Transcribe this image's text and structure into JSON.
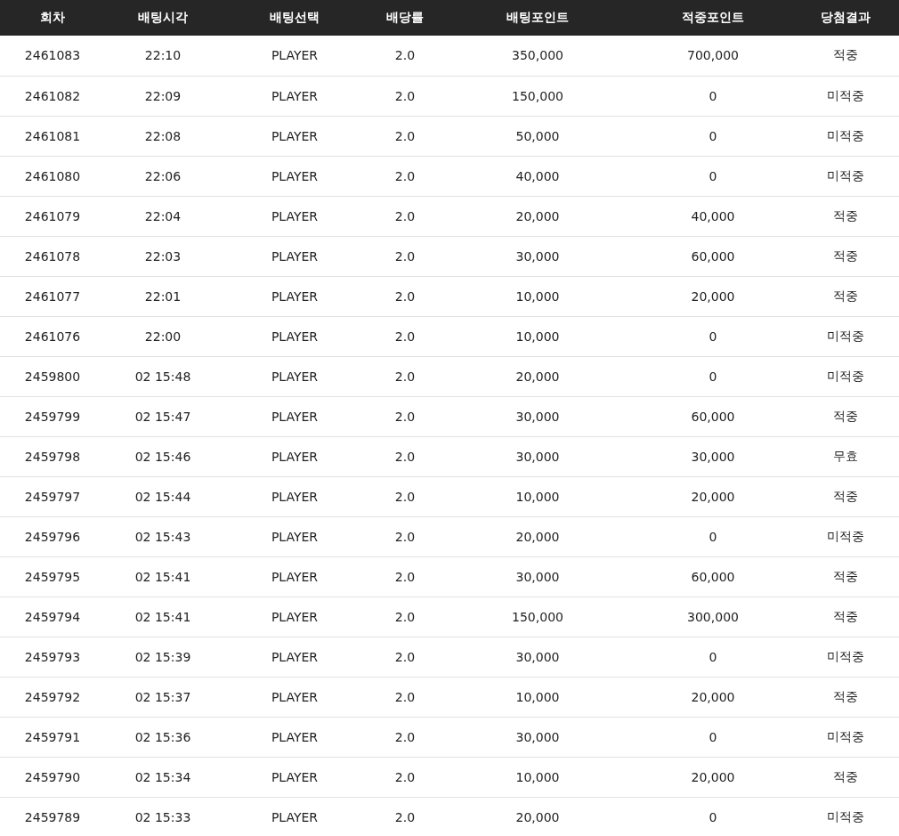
{
  "table": {
    "columns": [
      "회차",
      "배팅시각",
      "배팅선택",
      "배당률",
      "배팅포인트",
      "적중포인트",
      "당첨결과"
    ],
    "rows": [
      [
        "2461083",
        "22:10",
        "PLAYER",
        "2.0",
        "350,000",
        "700,000",
        "적중"
      ],
      [
        "2461082",
        "22:09",
        "PLAYER",
        "2.0",
        "150,000",
        "0",
        "미적중"
      ],
      [
        "2461081",
        "22:08",
        "PLAYER",
        "2.0",
        "50,000",
        "0",
        "미적중"
      ],
      [
        "2461080",
        "22:06",
        "PLAYER",
        "2.0",
        "40,000",
        "0",
        "미적중"
      ],
      [
        "2461079",
        "22:04",
        "PLAYER",
        "2.0",
        "20,000",
        "40,000",
        "적중"
      ],
      [
        "2461078",
        "22:03",
        "PLAYER",
        "2.0",
        "30,000",
        "60,000",
        "적중"
      ],
      [
        "2461077",
        "22:01",
        "PLAYER",
        "2.0",
        "10,000",
        "20,000",
        "적중"
      ],
      [
        "2461076",
        "22:00",
        "PLAYER",
        "2.0",
        "10,000",
        "0",
        "미적중"
      ],
      [
        "2459800",
        "02 15:48",
        "PLAYER",
        "2.0",
        "20,000",
        "0",
        "미적중"
      ],
      [
        "2459799",
        "02 15:47",
        "PLAYER",
        "2.0",
        "30,000",
        "60,000",
        "적중"
      ],
      [
        "2459798",
        "02 15:46",
        "PLAYER",
        "2.0",
        "30,000",
        "30,000",
        "무효"
      ],
      [
        "2459797",
        "02 15:44",
        "PLAYER",
        "2.0",
        "10,000",
        "20,000",
        "적중"
      ],
      [
        "2459796",
        "02 15:43",
        "PLAYER",
        "2.0",
        "20,000",
        "0",
        "미적중"
      ],
      [
        "2459795",
        "02 15:41",
        "PLAYER",
        "2.0",
        "30,000",
        "60,000",
        "적중"
      ],
      [
        "2459794",
        "02 15:41",
        "PLAYER",
        "2.0",
        "150,000",
        "300,000",
        "적중"
      ],
      [
        "2459793",
        "02 15:39",
        "PLAYER",
        "2.0",
        "30,000",
        "0",
        "미적중"
      ],
      [
        "2459792",
        "02 15:37",
        "PLAYER",
        "2.0",
        "10,000",
        "20,000",
        "적중"
      ],
      [
        "2459791",
        "02 15:36",
        "PLAYER",
        "2.0",
        "30,000",
        "0",
        "미적중"
      ],
      [
        "2459790",
        "02 15:34",
        "PLAYER",
        "2.0",
        "10,000",
        "20,000",
        "적중"
      ],
      [
        "2459789",
        "02 15:33",
        "PLAYER",
        "2.0",
        "20,000",
        "0",
        "미적중"
      ]
    ]
  }
}
